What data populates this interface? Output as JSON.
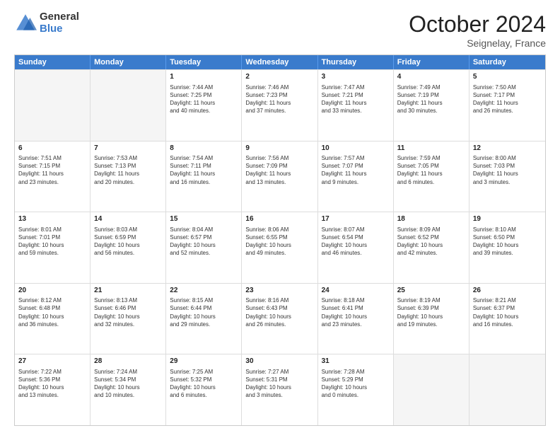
{
  "logo": {
    "general": "General",
    "blue": "Blue"
  },
  "title": "October 2024",
  "location": "Seignelay, France",
  "header_days": [
    "Sunday",
    "Monday",
    "Tuesday",
    "Wednesday",
    "Thursday",
    "Friday",
    "Saturday"
  ],
  "rows": [
    [
      {
        "day": "",
        "info": "",
        "empty": true
      },
      {
        "day": "",
        "info": "",
        "empty": true
      },
      {
        "day": "1",
        "info": "Sunrise: 7:44 AM\nSunset: 7:25 PM\nDaylight: 11 hours\nand 40 minutes."
      },
      {
        "day": "2",
        "info": "Sunrise: 7:46 AM\nSunset: 7:23 PM\nDaylight: 11 hours\nand 37 minutes."
      },
      {
        "day": "3",
        "info": "Sunrise: 7:47 AM\nSunset: 7:21 PM\nDaylight: 11 hours\nand 33 minutes."
      },
      {
        "day": "4",
        "info": "Sunrise: 7:49 AM\nSunset: 7:19 PM\nDaylight: 11 hours\nand 30 minutes."
      },
      {
        "day": "5",
        "info": "Sunrise: 7:50 AM\nSunset: 7:17 PM\nDaylight: 11 hours\nand 26 minutes."
      }
    ],
    [
      {
        "day": "6",
        "info": "Sunrise: 7:51 AM\nSunset: 7:15 PM\nDaylight: 11 hours\nand 23 minutes."
      },
      {
        "day": "7",
        "info": "Sunrise: 7:53 AM\nSunset: 7:13 PM\nDaylight: 11 hours\nand 20 minutes."
      },
      {
        "day": "8",
        "info": "Sunrise: 7:54 AM\nSunset: 7:11 PM\nDaylight: 11 hours\nand 16 minutes."
      },
      {
        "day": "9",
        "info": "Sunrise: 7:56 AM\nSunset: 7:09 PM\nDaylight: 11 hours\nand 13 minutes."
      },
      {
        "day": "10",
        "info": "Sunrise: 7:57 AM\nSunset: 7:07 PM\nDaylight: 11 hours\nand 9 minutes."
      },
      {
        "day": "11",
        "info": "Sunrise: 7:59 AM\nSunset: 7:05 PM\nDaylight: 11 hours\nand 6 minutes."
      },
      {
        "day": "12",
        "info": "Sunrise: 8:00 AM\nSunset: 7:03 PM\nDaylight: 11 hours\nand 3 minutes."
      }
    ],
    [
      {
        "day": "13",
        "info": "Sunrise: 8:01 AM\nSunset: 7:01 PM\nDaylight: 10 hours\nand 59 minutes."
      },
      {
        "day": "14",
        "info": "Sunrise: 8:03 AM\nSunset: 6:59 PM\nDaylight: 10 hours\nand 56 minutes."
      },
      {
        "day": "15",
        "info": "Sunrise: 8:04 AM\nSunset: 6:57 PM\nDaylight: 10 hours\nand 52 minutes."
      },
      {
        "day": "16",
        "info": "Sunrise: 8:06 AM\nSunset: 6:55 PM\nDaylight: 10 hours\nand 49 minutes."
      },
      {
        "day": "17",
        "info": "Sunrise: 8:07 AM\nSunset: 6:54 PM\nDaylight: 10 hours\nand 46 minutes."
      },
      {
        "day": "18",
        "info": "Sunrise: 8:09 AM\nSunset: 6:52 PM\nDaylight: 10 hours\nand 42 minutes."
      },
      {
        "day": "19",
        "info": "Sunrise: 8:10 AM\nSunset: 6:50 PM\nDaylight: 10 hours\nand 39 minutes."
      }
    ],
    [
      {
        "day": "20",
        "info": "Sunrise: 8:12 AM\nSunset: 6:48 PM\nDaylight: 10 hours\nand 36 minutes."
      },
      {
        "day": "21",
        "info": "Sunrise: 8:13 AM\nSunset: 6:46 PM\nDaylight: 10 hours\nand 32 minutes."
      },
      {
        "day": "22",
        "info": "Sunrise: 8:15 AM\nSunset: 6:44 PM\nDaylight: 10 hours\nand 29 minutes."
      },
      {
        "day": "23",
        "info": "Sunrise: 8:16 AM\nSunset: 6:43 PM\nDaylight: 10 hours\nand 26 minutes."
      },
      {
        "day": "24",
        "info": "Sunrise: 8:18 AM\nSunset: 6:41 PM\nDaylight: 10 hours\nand 23 minutes."
      },
      {
        "day": "25",
        "info": "Sunrise: 8:19 AM\nSunset: 6:39 PM\nDaylight: 10 hours\nand 19 minutes."
      },
      {
        "day": "26",
        "info": "Sunrise: 8:21 AM\nSunset: 6:37 PM\nDaylight: 10 hours\nand 16 minutes."
      }
    ],
    [
      {
        "day": "27",
        "info": "Sunrise: 7:22 AM\nSunset: 5:36 PM\nDaylight: 10 hours\nand 13 minutes."
      },
      {
        "day": "28",
        "info": "Sunrise: 7:24 AM\nSunset: 5:34 PM\nDaylight: 10 hours\nand 10 minutes."
      },
      {
        "day": "29",
        "info": "Sunrise: 7:25 AM\nSunset: 5:32 PM\nDaylight: 10 hours\nand 6 minutes."
      },
      {
        "day": "30",
        "info": "Sunrise: 7:27 AM\nSunset: 5:31 PM\nDaylight: 10 hours\nand 3 minutes."
      },
      {
        "day": "31",
        "info": "Sunrise: 7:28 AM\nSunset: 5:29 PM\nDaylight: 10 hours\nand 0 minutes."
      },
      {
        "day": "",
        "info": "",
        "empty": true
      },
      {
        "day": "",
        "info": "",
        "empty": true
      }
    ]
  ]
}
